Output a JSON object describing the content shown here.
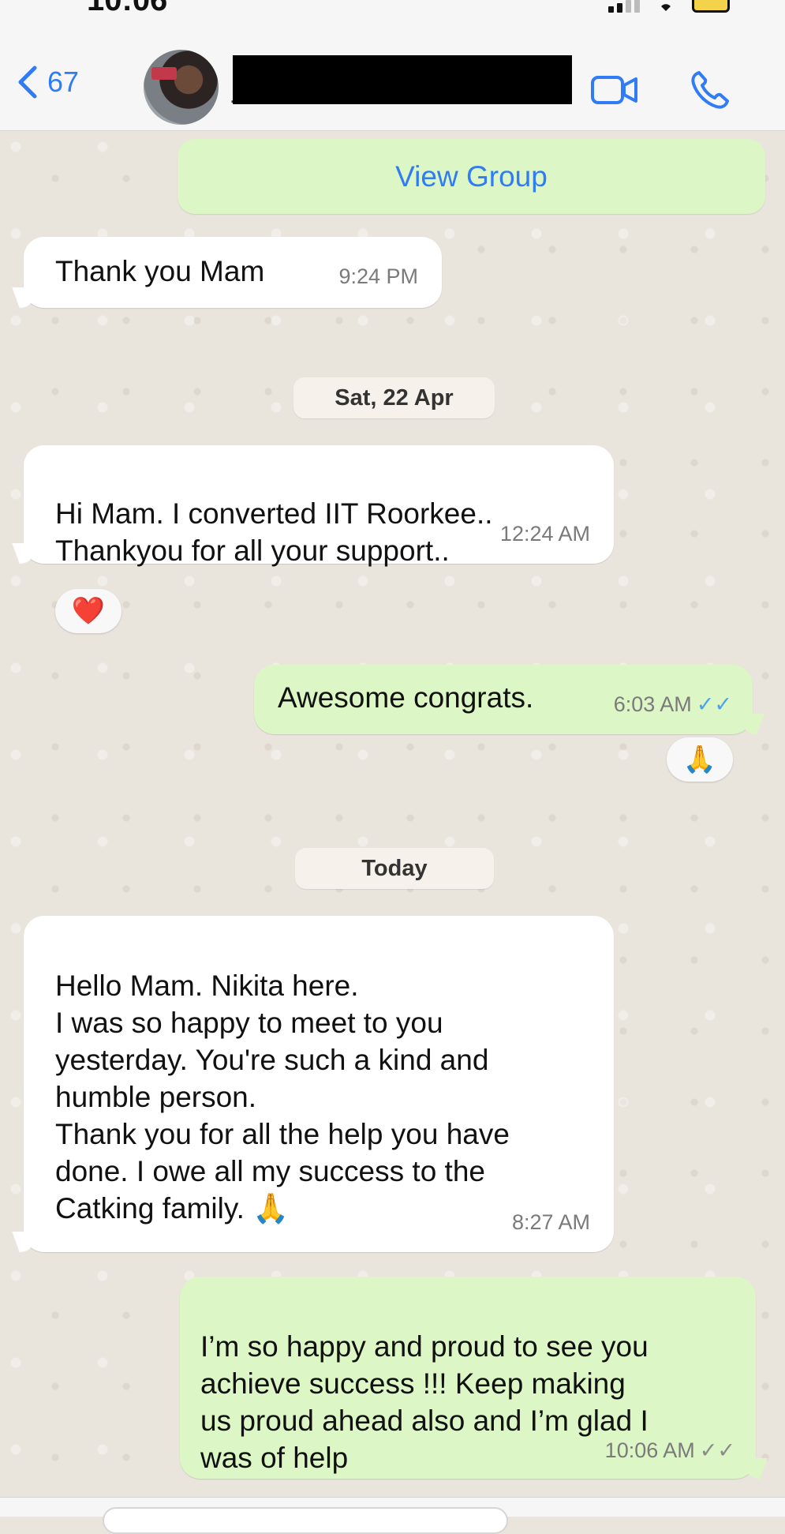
{
  "status_bar": {
    "time": "10:06"
  },
  "header": {
    "back_count": "67",
    "contact_name_fragment": "-",
    "icons": [
      "chevron-left-icon",
      "video-call-icon",
      "phone-icon"
    ]
  },
  "system": {
    "view_group": "View Group"
  },
  "messages": [
    {
      "direction": "in",
      "text": "Thank you Mam",
      "time": "9:24 PM"
    },
    {
      "type": "date",
      "label": "Sat, 22 Apr"
    },
    {
      "direction": "in",
      "text": "Hi Mam. I converted IIT Roorkee..\nThankyou for all your support..",
      "time": "12:24 AM",
      "reaction": "❤️"
    },
    {
      "direction": "out",
      "text": "Awesome congrats.",
      "time": "6:03 AM",
      "status": "read",
      "reaction": "🙏"
    },
    {
      "type": "date",
      "label": "Today"
    },
    {
      "direction": "in",
      "text": "Hello Mam. Nikita here.\nI was so happy to meet to you\nyesterday. You're such a kind and\nhumble person.\nThank you for all the help you have\ndone. I owe all my success to the\nCatking family. 🙏",
      "time": "8:27 AM"
    },
    {
      "direction": "out",
      "text": "I’m so happy and proud to see you\nachieve success !!! Keep making\nus proud ahead also and I’m glad I\nwas of help",
      "time": "10:06 AM",
      "status": "delivered"
    }
  ],
  "colors": {
    "accent": "#2f7cf6",
    "incoming_bubble": "#ffffff",
    "outgoing_bubble": "#dcf7c5",
    "chat_background": "#e9e4dc",
    "read_ticks": "#4aa3ef"
  }
}
